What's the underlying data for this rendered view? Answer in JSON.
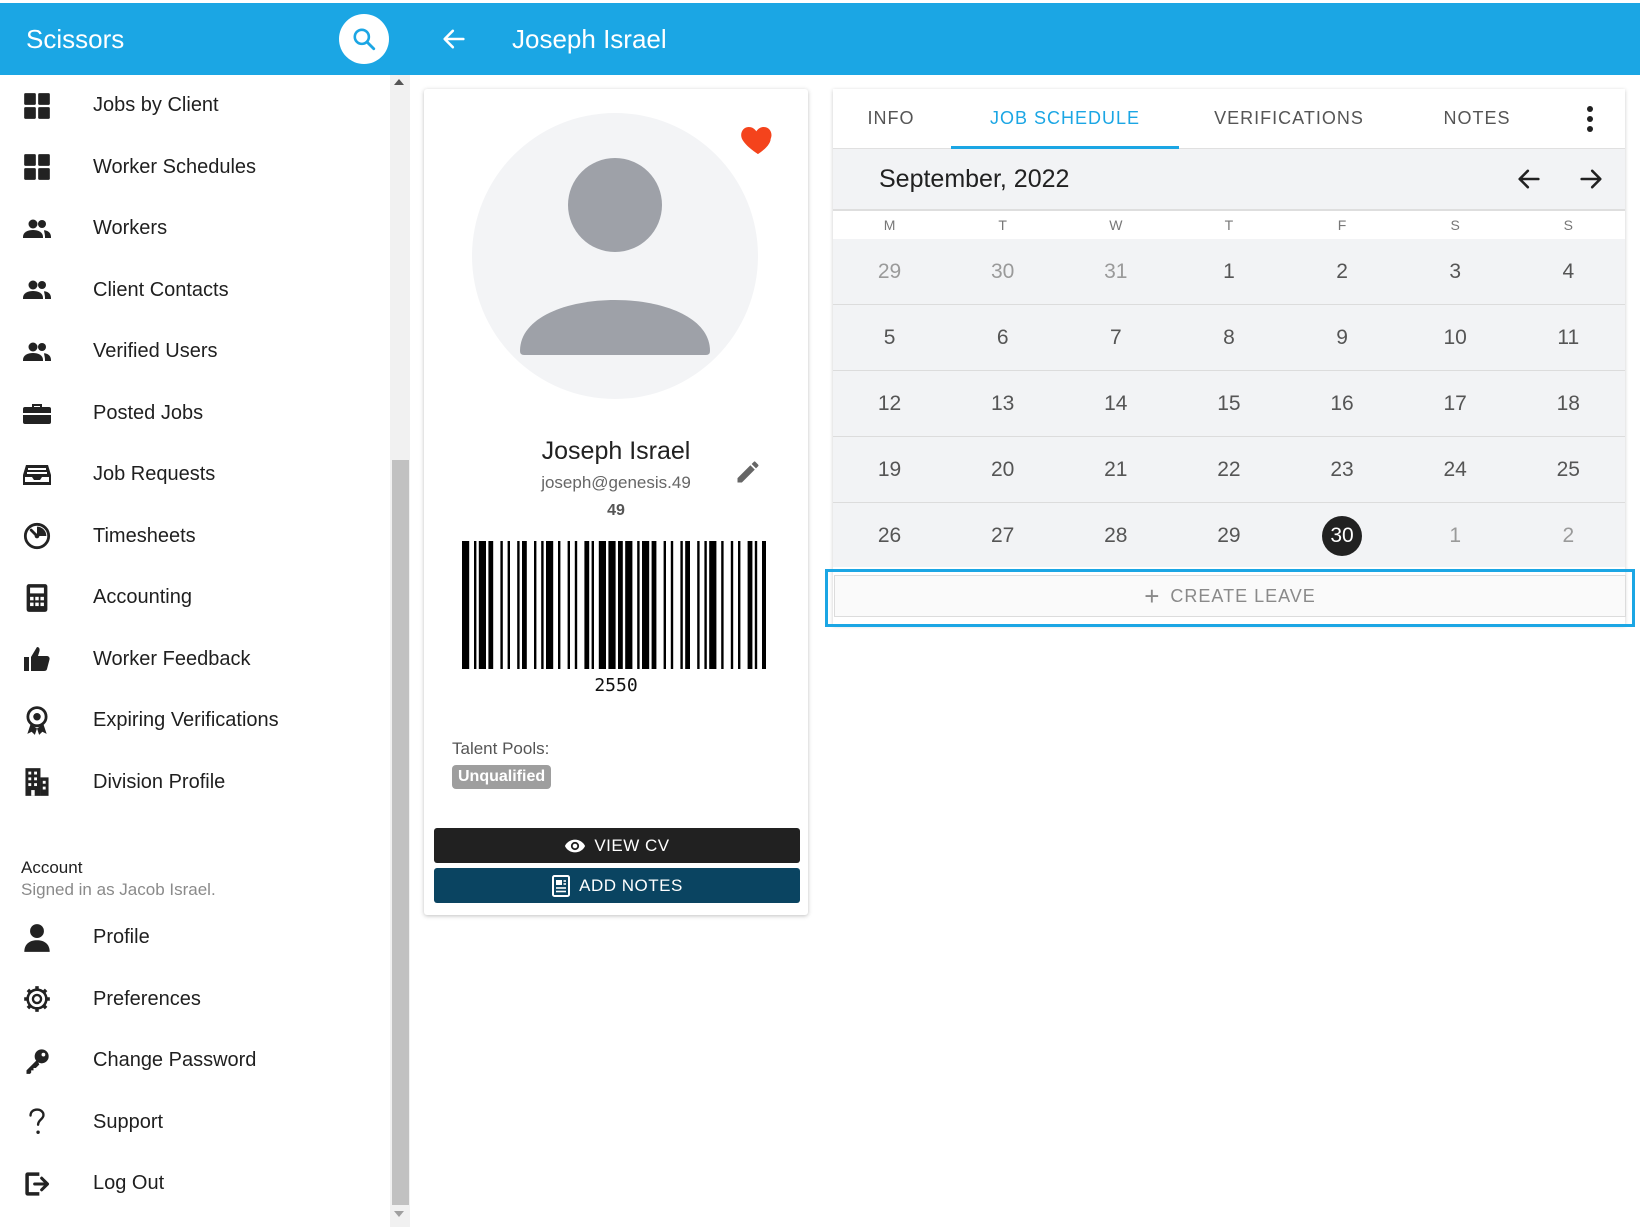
{
  "app": {
    "title": "Scissors"
  },
  "header": {
    "title": "Joseph Israel"
  },
  "sidebar": {
    "items": [
      {
        "label": "Jobs by Client",
        "icon": "grid-icon"
      },
      {
        "label": "Worker Schedules",
        "icon": "grid-icon"
      },
      {
        "label": "Workers",
        "icon": "people-icon"
      },
      {
        "label": "Client Contacts",
        "icon": "people-icon"
      },
      {
        "label": "Verified Users",
        "icon": "people-icon"
      },
      {
        "label": "Posted Jobs",
        "icon": "briefcase-icon"
      },
      {
        "label": "Job Requests",
        "icon": "inbox-icon"
      },
      {
        "label": "Timesheets",
        "icon": "timer-icon"
      },
      {
        "label": "Accounting",
        "icon": "calculator-icon"
      },
      {
        "label": "Worker Feedback",
        "icon": "thumbs-up-icon"
      },
      {
        "label": "Expiring Verifications",
        "icon": "award-icon"
      },
      {
        "label": "Division Profile",
        "icon": "building-icon"
      }
    ],
    "account": {
      "heading": "Account",
      "signed_in": "Signed in as Jacob Israel.",
      "items": [
        {
          "label": "Profile",
          "icon": "person-icon"
        },
        {
          "label": "Preferences",
          "icon": "gear-icon"
        },
        {
          "label": "Change Password",
          "icon": "key-icon"
        },
        {
          "label": "Support",
          "icon": "question-icon"
        },
        {
          "label": "Log Out",
          "icon": "logout-icon"
        }
      ]
    }
  },
  "profile": {
    "name": "Joseph Israel",
    "email": "joseph@genesis.49",
    "number": "49",
    "barcode_value": "2550",
    "talent_pools_label": "Talent Pools:",
    "talent_pool": "Unqualified",
    "view_cv": "VIEW CV",
    "add_notes": "ADD NOTES",
    "favorite_color": "#f4431c"
  },
  "tabs": [
    {
      "label": "INFO",
      "active": false
    },
    {
      "label": "JOB SCHEDULE",
      "active": true
    },
    {
      "label": "VERIFICATIONS",
      "active": false
    },
    {
      "label": "NOTES",
      "active": false
    }
  ],
  "calendar": {
    "month": "September, 2022",
    "weekdays": [
      "M",
      "T",
      "W",
      "T",
      "F",
      "S",
      "S"
    ],
    "weeks": [
      [
        {
          "d": "29",
          "o": true
        },
        {
          "d": "30",
          "o": true
        },
        {
          "d": "31",
          "o": true
        },
        {
          "d": "1"
        },
        {
          "d": "2"
        },
        {
          "d": "3"
        },
        {
          "d": "4"
        }
      ],
      [
        {
          "d": "5"
        },
        {
          "d": "6"
        },
        {
          "d": "7"
        },
        {
          "d": "8"
        },
        {
          "d": "9"
        },
        {
          "d": "10"
        },
        {
          "d": "11"
        }
      ],
      [
        {
          "d": "12"
        },
        {
          "d": "13"
        },
        {
          "d": "14"
        },
        {
          "d": "15"
        },
        {
          "d": "16"
        },
        {
          "d": "17"
        },
        {
          "d": "18"
        }
      ],
      [
        {
          "d": "19"
        },
        {
          "d": "20"
        },
        {
          "d": "21"
        },
        {
          "d": "22"
        },
        {
          "d": "23"
        },
        {
          "d": "24"
        },
        {
          "d": "25"
        }
      ],
      [
        {
          "d": "26"
        },
        {
          "d": "27"
        },
        {
          "d": "28"
        },
        {
          "d": "29"
        },
        {
          "d": "30",
          "today": true
        },
        {
          "d": "1",
          "o": true
        },
        {
          "d": "2",
          "o": true
        }
      ]
    ],
    "create_leave": "CREATE LEAVE"
  },
  "colors": {
    "accent": "#1ba6e4",
    "dark_button": "#212121",
    "notes_button": "#0a4461"
  }
}
